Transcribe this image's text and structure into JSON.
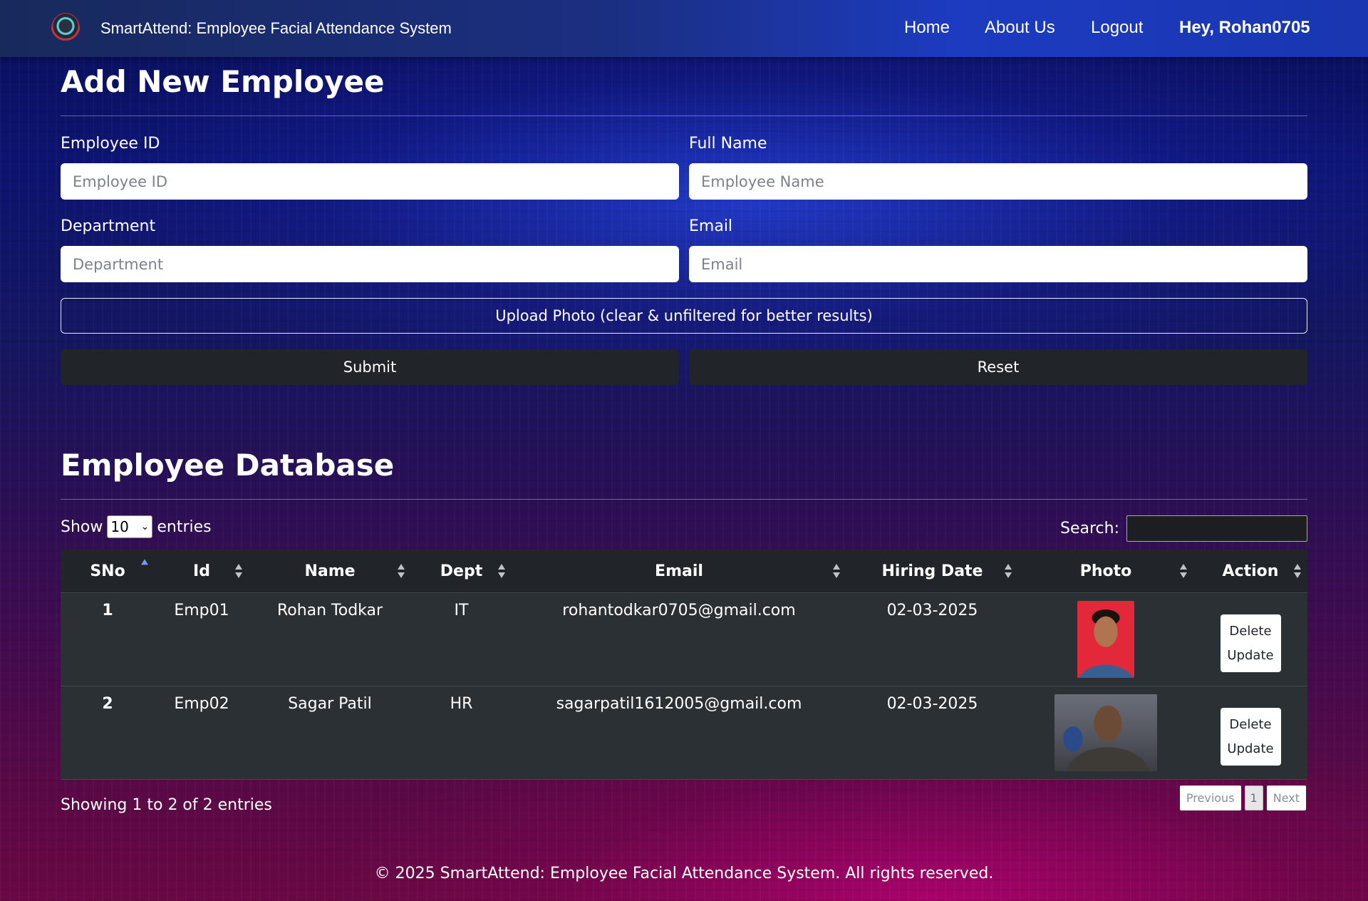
{
  "navbar": {
    "brand": "SmartAttend: Employee Facial Attendance System",
    "links": [
      "Home",
      "About Us",
      "Logout"
    ],
    "greeting": "Hey, Rohan0705"
  },
  "form": {
    "title": "Add New Employee",
    "employee_id": {
      "label": "Employee ID",
      "placeholder": "Employee ID",
      "value": ""
    },
    "full_name": {
      "label": "Full Name",
      "placeholder": "Employee Name",
      "value": ""
    },
    "department": {
      "label": "Department",
      "placeholder": "Department",
      "value": ""
    },
    "email": {
      "label": "Email",
      "placeholder": "Email",
      "value": ""
    },
    "upload_label": "Upload Photo (clear & unfiltered for better results)",
    "submit_label": "Submit",
    "reset_label": "Reset"
  },
  "database": {
    "title": "Employee Database",
    "show_label": "Show",
    "entries_value": "10",
    "entries_label": "entries",
    "search_label": "Search:",
    "columns": [
      "SNo",
      "Id",
      "Name",
      "Dept",
      "Email",
      "Hiring Date",
      "Photo",
      "Action"
    ],
    "rows": [
      {
        "sno": "1",
        "id": "Emp01",
        "name": "Rohan Todkar",
        "dept": "IT",
        "email": "rohantodkar0705@gmail.com",
        "hiring_date": "02-03-2025",
        "delete": "Delete",
        "update": "Update"
      },
      {
        "sno": "2",
        "id": "Emp02",
        "name": "Sagar Patil",
        "dept": "HR",
        "email": "sagarpatil1612005@gmail.com",
        "hiring_date": "02-03-2025",
        "delete": "Delete",
        "update": "Update"
      }
    ],
    "showing_text": "Showing 1 to 2 of 2 entries",
    "pagination": {
      "previous": "Previous",
      "current": "1",
      "next": "Next"
    }
  },
  "footer": "© 2025 SmartAttend: Employee Facial Attendance System. All rights reserved.",
  "colors": {
    "navbar": "#1c3bc0",
    "dark_button": "#212529",
    "table_header": "#212529",
    "table_row": "#2b3035"
  }
}
